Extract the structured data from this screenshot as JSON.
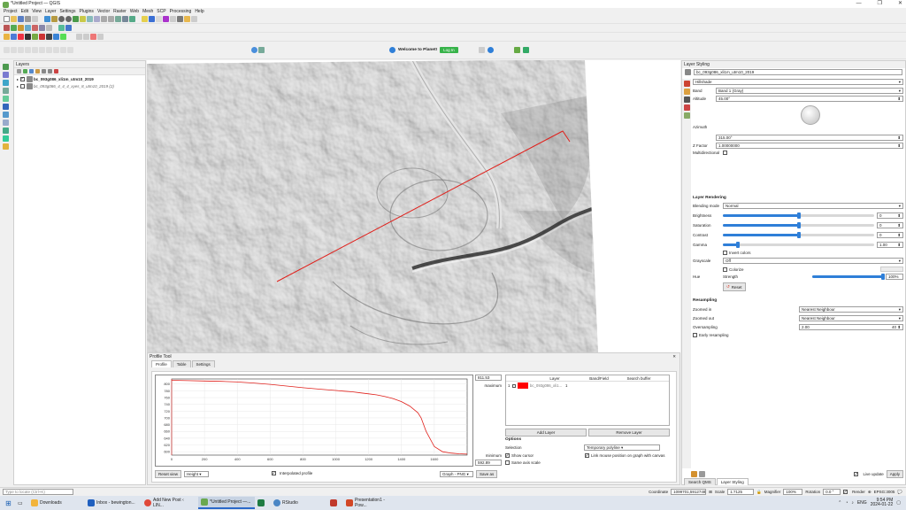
{
  "window": {
    "title": "*Untitled Project — QGIS"
  },
  "menu": [
    "Project",
    "Edit",
    "View",
    "Layer",
    "Settings",
    "Plugins",
    "Vector",
    "Raster",
    "Web",
    "Mesh",
    "SCP",
    "Processing",
    "Help"
  ],
  "planet": {
    "welcome": "Welcome to Planet!",
    "login": "Log In"
  },
  "layers_panel": {
    "title": "Layers",
    "items": [
      {
        "name": "bc_093g086_xli1m_utm10_2019",
        "checked": true,
        "bold": true
      },
      {
        "name": "bc_093g086_4_4_4_xyes_8_utm10_2019 (2)",
        "checked": false,
        "bold": false
      }
    ]
  },
  "profile_tool": {
    "title": "Profile Tool",
    "tabs": [
      "Profile",
      "Table",
      "Settings"
    ],
    "chart_data": {
      "type": "line",
      "x_ticks": [
        "0",
        "200",
        "400",
        "600",
        "800",
        "1000",
        "1200",
        "1400",
        "1600"
      ],
      "y_ticks": [
        "600",
        "620",
        "640",
        "660",
        "680",
        "700",
        "720",
        "740",
        "760",
        "780",
        "800"
      ],
      "x": [
        0,
        100,
        200,
        300,
        400,
        500,
        600,
        700,
        800,
        900,
        1000,
        1050,
        1100,
        1150,
        1200,
        1250,
        1300,
        1350,
        1400,
        1450,
        1500,
        1520,
        1550,
        1600,
        1650,
        1700,
        1750,
        1800
      ],
      "y": [
        811,
        810,
        809,
        808,
        806,
        803,
        799,
        794,
        789,
        785,
        781,
        779,
        777,
        774,
        771,
        768,
        763,
        757,
        748,
        735,
        715,
        700,
        660,
        615,
        600,
        596,
        594,
        593
      ],
      "xlim": [
        0,
        1800
      ],
      "ylim": [
        590,
        815
      ]
    },
    "max_value": "811.53",
    "max_label": "maximum",
    "min_value": "592.89",
    "min_label": "minimum",
    "reset_view": "Reset view",
    "height_option": "Height",
    "interpolated": "Interpolated profile",
    "graph_option": "Graph - PNG",
    "save_as": "Save as",
    "layer_table": {
      "columns": [
        "Layer",
        "Band/Field",
        "Search buffer"
      ],
      "rows": [
        {
          "index": "1",
          "layer": "bc_093g086_xli1...",
          "band": "1",
          "color": "#ff0000"
        }
      ]
    },
    "add_layer": "Add Layer",
    "remove_layer": "Remove Layer",
    "options": {
      "title": "Options",
      "selection_label": "Selection",
      "selection_value": "Temporary polyline",
      "show_cursor": "Show cursor",
      "link_mouse": "Link mouse position on graph with canvas",
      "same_axis": "Same axis scale"
    }
  },
  "styling_panel": {
    "title": "Layer Styling",
    "layer_select": "bc_093g086_xli1m_utm10_2019",
    "renderer": "Hillshade",
    "band_label": "Band",
    "band_value": "Band 1 (Gray)",
    "altitude_label": "Altitude",
    "altitude_value": "45.00°",
    "azimuth_label": "Azimuth",
    "azimuth_value": "315.00°",
    "zfactor_label": "Z Factor",
    "zfactor_value": "1.00000000",
    "multidirectional": "Multidirectional",
    "rendering_title": "Layer Rendering",
    "blending_label": "Blending mode",
    "blending_value": "Normal",
    "brightness_label": "Brightness",
    "brightness_value": "0",
    "brightness_level": 0.5,
    "saturation_label": "Saturation",
    "saturation_value": "0",
    "saturation_level": 0.5,
    "contrast_label": "Contrast",
    "contrast_value": "0",
    "contrast_level": 0.5,
    "gamma_label": "Gamma",
    "gamma_value": "1.00",
    "gamma_level": 0.1,
    "invert_colors": "Invert colors",
    "grayscale_label": "Grayscale",
    "grayscale_value": "Off",
    "hue_label": "Hue",
    "colorize": "Colorize",
    "strength_label": "Strength",
    "strength_value": "100%",
    "strength_level": 1.0,
    "reset": "Reset",
    "resampling_title": "Resampling",
    "zoomed_in_label": "Zoomed in",
    "zoomed_in_value": "Nearest Neighbour",
    "zoomed_out_label": "Zoomed out",
    "zoomed_out_value": "Nearest Neighbour",
    "oversampling_label": "Oversampling",
    "oversampling_value": "2.00",
    "oversampling_max": "40",
    "early_resampling": "Early resampling",
    "live_update": "Live update",
    "apply": "Apply",
    "bottom_tabs": [
      "Search QMS",
      "Layer Styling"
    ]
  },
  "status": {
    "locate_placeholder": "Type to locate (Ctrl+K)",
    "coordinate_label": "Coordinate",
    "coordinate_value": "109‌9701,5912748",
    "scale_label": "Scale",
    "scale_value": "1:7125",
    "magnifier_label": "Magnifier",
    "magnifier_value": "100%",
    "rotation_label": "Rotation",
    "rotation_value": "0.0 °",
    "render_label": "Render",
    "crs": "EPSG:3005"
  },
  "taskbar": {
    "items": [
      {
        "label": "Downloads",
        "color": "#f2b43c"
      },
      {
        "label": "Inbox - bewington...",
        "color": "#1f5fbf"
      },
      {
        "label": "Add New Post ‹ LIN...",
        "color": "#e0493a"
      },
      {
        "label": "*Untitled Project —...",
        "color": "#6aa84f",
        "active": true
      },
      {
        "label": "",
        "color": "#1e7b43"
      },
      {
        "label": "RStudio",
        "color": "#4a86c5"
      },
      {
        "label": "",
        "color": "#c0392b"
      },
      {
        "label": "Presentation1 - Pow...",
        "color": "#d24726"
      }
    ],
    "lang": "ENG",
    "time": "9:54 PM",
    "date": "2024-01-22"
  },
  "colors": {
    "profile_line": "#e0201b",
    "accent": "#2f7fd8",
    "planet_login": "#37b34a"
  }
}
